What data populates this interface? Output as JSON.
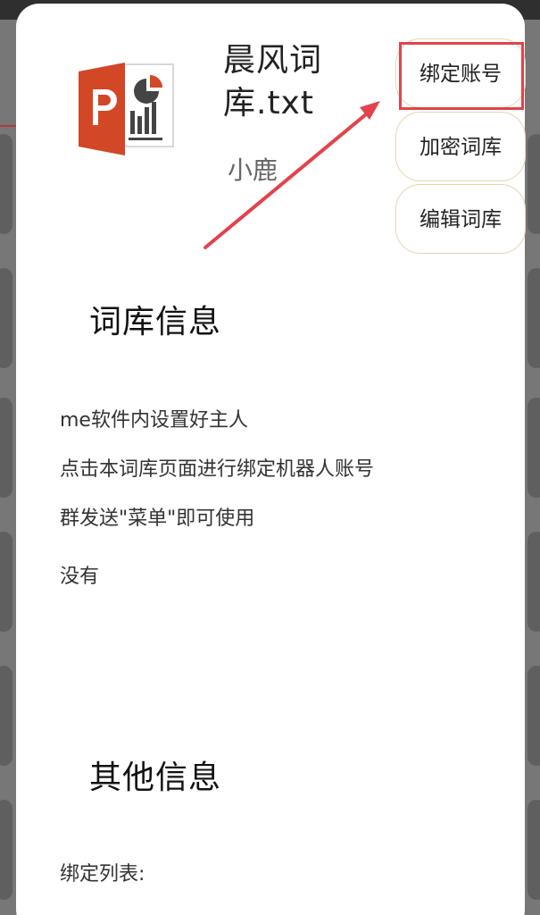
{
  "file": {
    "name": "晨风词库.txt",
    "author": "小鹿",
    "icon": "powerpoint-file-icon"
  },
  "actions": {
    "bind_account": "绑定账号",
    "encrypt_library": "加密词库",
    "edit_library": "编辑词库"
  },
  "library_info": {
    "title": "词库信息",
    "lines": [
      "me软件内设置好主人",
      "点击本词库页面进行绑定机器人账号",
      "群发送\"菜单\"即可使用",
      "没有"
    ]
  },
  "other_info": {
    "title": "其他信息",
    "binding_list_label": "绑定列表:"
  },
  "colors": {
    "card_bg": "#ffffff",
    "button_border": "#e7d4b0",
    "highlight_red": "#e2434b",
    "powerpoint_orange": "#d24726"
  }
}
